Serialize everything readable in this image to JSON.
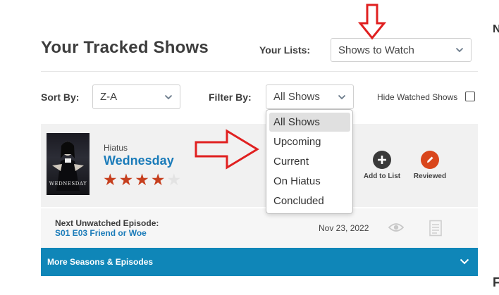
{
  "header": {
    "title": "Your Tracked Shows",
    "lists_label": "Your Lists:",
    "lists_value": "Shows to Watch"
  },
  "filters": {
    "sort_label": "Sort By:",
    "sort_value": "Z-A",
    "filter_label": "Filter By:",
    "filter_value": "All Shows",
    "hide_watched_label": "Hide Watched Shows",
    "hide_watched_checked": false
  },
  "dropdown": {
    "options": [
      "All Shows",
      "Upcoming",
      "Current",
      "On Hiatus",
      "Concluded"
    ],
    "selected": "All Shows"
  },
  "show": {
    "status": "Hiatus",
    "title": "Wednesday",
    "poster_text": "WEDNESDAY",
    "rating": 4,
    "rating_max": 5,
    "actions": {
      "add_label": "Add to List",
      "reviewed_label": "Reviewed"
    },
    "next_label": "Next Unwatched Episode:",
    "next_episode": "S01 E03 Friend or Woe",
    "air_date": "Nov 23, 2022",
    "more_label": "More Seasons & Episodes"
  },
  "edge": {
    "top_letter": "N",
    "bottom_letter": "F"
  },
  "colors": {
    "accent": "#0f86b8",
    "link": "#1a7bb9",
    "star": "#c63f1e",
    "reviewed": "#d9461c",
    "add": "#3a3a3a",
    "annotation_arrow": "#e02020"
  }
}
